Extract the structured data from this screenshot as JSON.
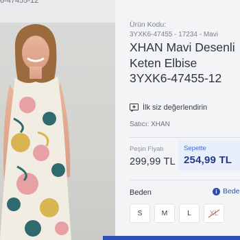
{
  "top_fragment": "6-47455-12",
  "product": {
    "code_label": "Ürün Kodu:",
    "code_value": "3YXK6-47455 - 17234 - Mavi",
    "title": "XHAN Mavi Desenli Keten Elbise 3YXK6-47455-12",
    "rate_label": "İlk siz değerlendirin",
    "seller": "Satıcı: XHAN"
  },
  "pricing": {
    "cash_label": "Peşin Fiyatı",
    "cash_price": "299,99 TL",
    "basket_label": "Sepette",
    "basket_price": "254,99 TL"
  },
  "sizes": {
    "title": "Beden",
    "guide_label": "Beden",
    "options": [
      "S",
      "M",
      "L",
      "XL"
    ],
    "unavailable": [
      "XL"
    ]
  },
  "icons": {
    "rate": "comment-plus-icon",
    "info": "info-icon"
  },
  "colors": {
    "accent": "#2b4fb5",
    "basket_bg": "#e8eefc",
    "basket_price": "#233a8a"
  }
}
